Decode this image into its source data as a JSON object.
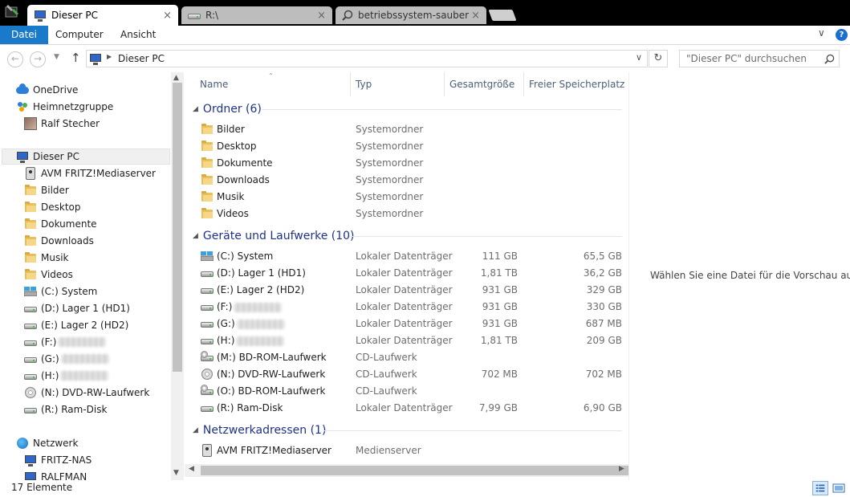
{
  "tabs": [
    {
      "title": "Dieser PC",
      "close": "×"
    },
    {
      "title": "R:\\",
      "close": "×"
    },
    {
      "title": "betriebssystem-sauber",
      "close": "×"
    }
  ],
  "ribbon": {
    "file": "Datei",
    "computer": "Computer",
    "view": "Ansicht",
    "help": "?"
  },
  "address": {
    "path": "Dieser PC",
    "search_placeholder": "\"Dieser PC\" durchsuchen"
  },
  "nav": {
    "onedrive": "OneDrive",
    "homegroup": "Heimnetzgruppe",
    "user": "Ralf Stecher",
    "thispc": "Dieser PC",
    "items": [
      "AVM FRITZ!Mediaserver",
      "Bilder",
      "Desktop",
      "Dokumente",
      "Downloads",
      "Musik",
      "Videos",
      "(C:) System",
      "(D:) Lager 1 (HD1)",
      "(E:) Lager 2 (HD2)",
      "(F:)",
      "(G:)",
      "(H:)",
      "(N:) DVD-RW-Laufwerk",
      "(R:) Ram-Disk"
    ],
    "network": "Netzwerk",
    "net_items": [
      "FRITZ-NAS",
      "RALFMAN"
    ]
  },
  "columns": {
    "name": "Name",
    "type": "Typ",
    "total": "Gesamtgröße",
    "free": "Freier Speicherplatz"
  },
  "groups": {
    "folders": {
      "title": "Ordner (6)",
      "items": [
        {
          "name": "Bilder",
          "type": "Systemordner"
        },
        {
          "name": "Desktop",
          "type": "Systemordner"
        },
        {
          "name": "Dokumente",
          "type": "Systemordner"
        },
        {
          "name": "Downloads",
          "type": "Systemordner"
        },
        {
          "name": "Musik",
          "type": "Systemordner"
        },
        {
          "name": "Videos",
          "type": "Systemordner"
        }
      ]
    },
    "drives": {
      "title": "Geräte und Laufwerke (10)",
      "items": [
        {
          "name": "(C:) System",
          "type": "Lokaler Datenträger",
          "total": "111 GB",
          "free": "65,5 GB"
        },
        {
          "name": "(D:) Lager 1 (HD1)",
          "type": "Lokaler Datenträger",
          "total": "1,81 TB",
          "free": "36,2 GB"
        },
        {
          "name": "(E:) Lager 2 (HD2)",
          "type": "Lokaler Datenträger",
          "total": "931 GB",
          "free": "329 GB"
        },
        {
          "name": "(F:)",
          "type": "Lokaler Datenträger",
          "total": "931 GB",
          "free": "330 GB"
        },
        {
          "name": "(G:)",
          "type": "Lokaler Datenträger",
          "total": "931 GB",
          "free": "687 MB"
        },
        {
          "name": "(H:)",
          "type": "Lokaler Datenträger",
          "total": "1,81 TB",
          "free": "209 GB"
        },
        {
          "name": "(M:) BD-ROM-Laufwerk",
          "type": "CD-Laufwerk",
          "total": "",
          "free": ""
        },
        {
          "name": "(N:) DVD-RW-Laufwerk",
          "type": "CD-Laufwerk",
          "total": "702 MB",
          "free": "702 MB"
        },
        {
          "name": "(O:) BD-ROM-Laufwerk",
          "type": "CD-Laufwerk",
          "total": "",
          "free": ""
        },
        {
          "name": "(R:) Ram-Disk",
          "type": "Lokaler Datenträger",
          "total": "7,99 GB",
          "free": "6,90 GB"
        }
      ]
    },
    "network": {
      "title": "Netzwerkadressen (1)",
      "items": [
        {
          "name": "AVM FRITZ!Mediaserver",
          "type": "Medienserver"
        }
      ]
    }
  },
  "preview": "Wählen Sie eine Datei für die Vorschau aus.",
  "status": "17 Elemente",
  "colors": {
    "accent": "#1979ca",
    "group_title": "#1e3287",
    "column_header": "#4c607a"
  }
}
